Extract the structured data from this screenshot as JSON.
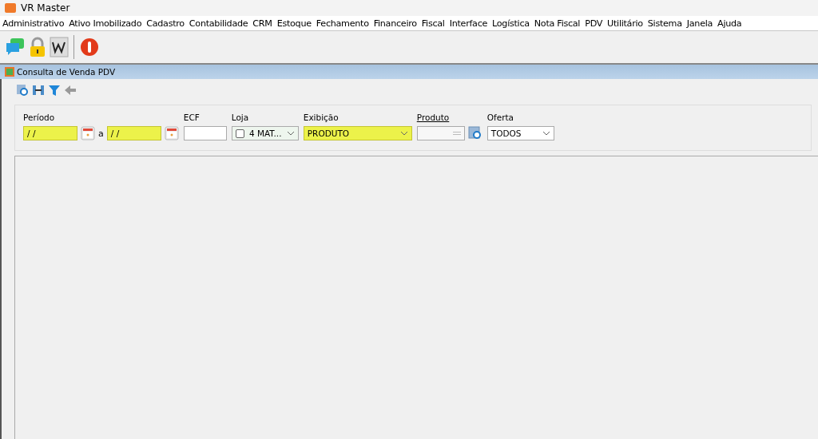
{
  "window": {
    "title": "VR Master"
  },
  "menu": [
    "Administrativo",
    "Ativo Imobilizado",
    "Cadastro",
    "Contabilidade",
    "CRM",
    "Estoque",
    "Fechamento",
    "Financeiro",
    "Fiscal",
    "Interface",
    "Logística",
    "Nota Fiscal",
    "PDV",
    "Utilitário",
    "Sistema",
    "Janela",
    "Ajuda"
  ],
  "internal_window": {
    "title": "Consulta de Venda PDV"
  },
  "filters": {
    "periodo": {
      "label": "Período",
      "start": "/ /",
      "connector": "a",
      "end": "/ /",
      "highlighted": true
    },
    "ecf": {
      "label": "ECF",
      "highlighted": false
    },
    "loja": {
      "label": "Loja",
      "checked": false,
      "value": "4 MAT..."
    },
    "exibicao": {
      "label": "Exibição",
      "value": "PRODUTO",
      "highlighted": true
    },
    "produto": {
      "label": "Produto",
      "highlighted": false
    },
    "oferta": {
      "label": "Oferta",
      "value": "TODOS",
      "highlighted": false
    }
  }
}
